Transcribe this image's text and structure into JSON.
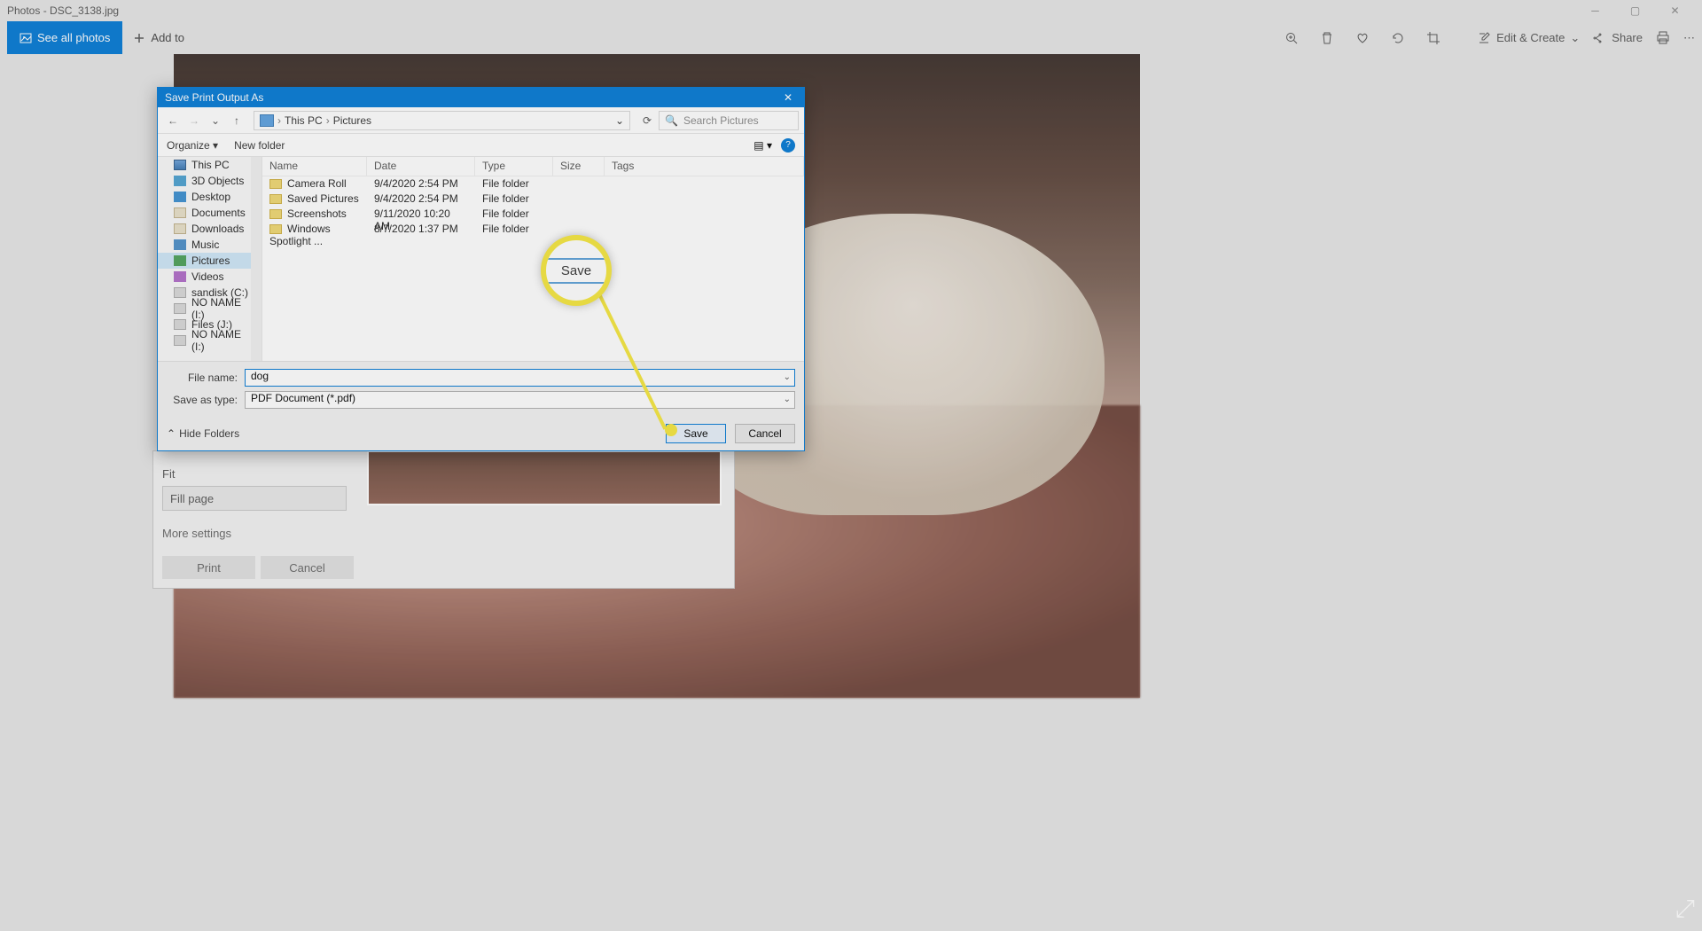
{
  "titlebar": {
    "title": "Photos - DSC_3138.jpg"
  },
  "toolbar": {
    "see_all": "See all photos",
    "add_to": "Add to",
    "edit_create": "Edit & Create",
    "share": "Share"
  },
  "print_panel": {
    "fit_label": "Fit",
    "fit_value": "Fill page",
    "more": "More settings",
    "print": "Print",
    "cancel": "Cancel"
  },
  "dialog": {
    "title": "Save Print Output As",
    "breadcrumbs": {
      "root": "This PC",
      "folder": "Pictures"
    },
    "search_placeholder": "Search Pictures",
    "organize": "Organize",
    "new_folder": "New folder",
    "tree": [
      {
        "label": "This PC",
        "icon": "ic-pc"
      },
      {
        "label": "3D Objects",
        "icon": "ic-obj"
      },
      {
        "label": "Desktop",
        "icon": "ic-desk"
      },
      {
        "label": "Documents",
        "icon": "ic-doc"
      },
      {
        "label": "Downloads",
        "icon": "ic-down"
      },
      {
        "label": "Music",
        "icon": "ic-music"
      },
      {
        "label": "Pictures",
        "icon": "ic-pic",
        "selected": true
      },
      {
        "label": "Videos",
        "icon": "ic-vid"
      },
      {
        "label": "sandisk (C:)",
        "icon": "ic-drive"
      },
      {
        "label": "NO NAME (I:)",
        "icon": "ic-drive"
      },
      {
        "label": "Files (J:)",
        "icon": "ic-drive"
      },
      {
        "label": "NO NAME (I:)",
        "icon": "ic-drive"
      }
    ],
    "columns": {
      "name": "Name",
      "date": "Date",
      "type": "Type",
      "size": "Size",
      "tags": "Tags"
    },
    "rows": [
      {
        "name": "Camera Roll",
        "date": "9/4/2020 2:54 PM",
        "type": "File folder"
      },
      {
        "name": "Saved Pictures",
        "date": "9/4/2020 2:54 PM",
        "type": "File folder"
      },
      {
        "name": "Screenshots",
        "date": "9/11/2020 10:20 AM",
        "type": "File folder"
      },
      {
        "name": "Windows Spotlight ...",
        "date": "8/7/2020 1:37 PM",
        "type": "File folder"
      }
    ],
    "file_name_label": "File name:",
    "file_name": "dog",
    "save_type_label": "Save as type:",
    "save_type": "PDF Document (*.pdf)",
    "hide_folders": "Hide Folders",
    "save": "Save",
    "cancel": "Cancel"
  },
  "callout": {
    "text": "Save"
  }
}
